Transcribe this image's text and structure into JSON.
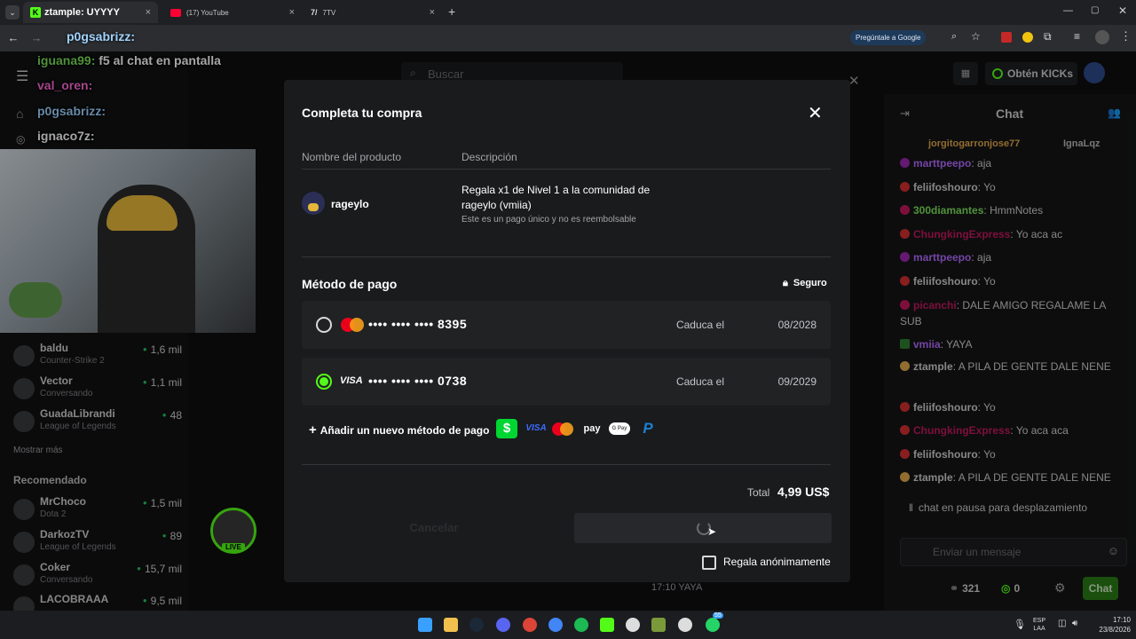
{
  "browser": {
    "tabs": [
      {
        "label": "ztample: UYYYY",
        "active": true
      },
      {
        "label": "(17) YouTube",
        "active": false
      },
      {
        "label": "7TV",
        "active": false
      }
    ],
    "new_tab": "+",
    "google_pill": "Pregúntale a Google",
    "overlay_name": "p0gsabrizz:"
  },
  "site": {
    "search_placeholder": "Buscar",
    "get_kicks": "Obtén KICKs",
    "overlay_chat": [
      {
        "user": "iguana99:",
        "text": "f5 al chat en pantalla"
      },
      {
        "user": "val_oren:",
        "text": ""
      },
      {
        "user": "p0gsabrizz:",
        "text": ""
      },
      {
        "user": "ignaco7z:",
        "text": ""
      }
    ],
    "followed": [
      {
        "name": "baldu",
        "game": "Counter-Strike 2",
        "viewers": "1,6 mil"
      },
      {
        "name": "Vector",
        "game": "Conversando",
        "viewers": "1,1 mil"
      },
      {
        "name": "GuadaLibrandi",
        "game": "League of Legends",
        "viewers": "48"
      }
    ],
    "show_more": "Mostrar más",
    "recommended_title": "Recomendado",
    "recommended": [
      {
        "name": "MrChoco",
        "game": "Dota 2",
        "viewers": "1,5 mil"
      },
      {
        "name": "DarkozTV",
        "game": "League of Legends",
        "viewers": "89"
      },
      {
        "name": "Coker",
        "game": "Conversando",
        "viewers": "15,7 mil"
      },
      {
        "name": "LACOBRAAA",
        "game": "",
        "viewers": "9,5 mil"
      }
    ],
    "live_badge": "LIVE",
    "chat_timestamp": "17:10 YAYA"
  },
  "chat": {
    "title": "Chat",
    "top_users": [
      "jorgitogarronjose77",
      "IgnaLqz"
    ],
    "messages": [
      {
        "user": "marttpeepo",
        "text": "aja",
        "color": "#b36bff"
      },
      {
        "user": "feliifoshouro",
        "text": "Yo",
        "color": "#e6e6e6"
      },
      {
        "user": "300diamantes",
        "text": "HmmNotes",
        "color": "#7be05a"
      },
      {
        "user": "ChungkingExpress",
        "text": "Yo aca ac",
        "color": "#c2185b"
      },
      {
        "user": "marttpeepo",
        "text": "aja",
        "color": "#b36bff"
      },
      {
        "user": "feliifoshouro",
        "text": "Yo",
        "color": "#e6e6e6"
      },
      {
        "user": "picanchi",
        "text": "DALE AMIGO REGALAME LA SUB",
        "color": "#c2185b"
      },
      {
        "user": "vmiia",
        "text": "YAYA",
        "color": "#b36bff"
      },
      {
        "user": "ztample",
        "text": "A PILA DE GENTE DALE NENE",
        "color": "#e6e6e6"
      },
      {
        "user": "feliifoshouro",
        "text": "Yo",
        "color": "#e6e6e6"
      },
      {
        "user": "ChungkingExpress",
        "text": "Yo aca aca",
        "color": "#c2185b"
      },
      {
        "user": "feliifoshouro",
        "text": "Yo",
        "color": "#e6e6e6"
      },
      {
        "user": "ztample",
        "text": "A PILA DE GENTE DALE NENE",
        "color": "#e6e6e6"
      }
    ],
    "paused": "chat en pausa para desplazamiento",
    "input_placeholder": "Enviar un mensaje",
    "points": "321",
    "kicks": "0",
    "send_label": "Chat"
  },
  "modal": {
    "title": "Completa tu compra",
    "col_product": "Nombre del producto",
    "col_description": "Descripción",
    "product_name": "rageylo",
    "description": "Regala x1 de Nivel 1 a la comunidad de rageylo (vmiia)",
    "note": "Este es un pago único y no es reembolsable",
    "payment_title": "Método de pago",
    "secure": "Seguro",
    "cards": [
      {
        "brand": "mastercard",
        "masked": "•••• •••• •••• 8395",
        "exp_label": "Caduca el",
        "exp": "08/2028",
        "selected": false
      },
      {
        "brand": "VISA",
        "masked": "•••• •••• •••• 0738",
        "exp_label": "Caduca el",
        "exp": "09/2029",
        "selected": true
      }
    ],
    "add_method": "Añadir un nuevo método de pago",
    "method_icons": [
      "cashapp-icon",
      "visa-icon",
      "mastercard-icon",
      "amazon-pay-icon",
      "google-pay-icon",
      "paypal-icon"
    ],
    "amazon_pay_label": "pay",
    "google_pay_label": "G Pay",
    "paypal_label": "P",
    "cashapp_label": "$",
    "visa_label": "VISA",
    "total_label": "Total",
    "total_value": "4,99 US$",
    "cancel": "Cancelar",
    "anonymous": "Regala anónimamente"
  },
  "taskbar": {
    "lang": "ESP",
    "lang2": "LAA",
    "time": "17:10",
    "date": "23/8/2026",
    "badge": "55"
  },
  "colors": {
    "kick_green": "#53fc18",
    "modal_bg": "#191b1c"
  }
}
